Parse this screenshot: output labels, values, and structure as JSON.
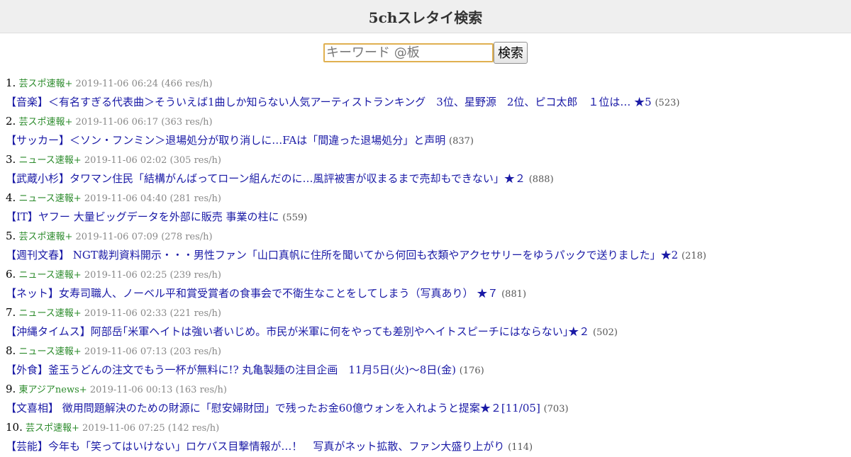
{
  "header": {
    "title": "5chスレタイ検索"
  },
  "search": {
    "placeholder": "キーワード @板",
    "value": "",
    "button_label": "検索"
  },
  "results": [
    {
      "rank": "1.",
      "board": "芸スポ速報+",
      "date": "2019-11-06 06:24",
      "rate": "(466 res/h)",
      "title": "【音楽】＜有名すぎる代表曲＞そういえば1曲しか知らない人気アーティストランキング　3位、星野源　2位、ピコ太郎　１位は… ★5",
      "count": "(523)"
    },
    {
      "rank": "2.",
      "board": "芸スポ速報+",
      "date": "2019-11-06 06:17",
      "rate": "(363 res/h)",
      "title": "【サッカー】＜ソン・フンミン＞退場処分が取り消しに…FAは「間違った退場処分」と声明",
      "count": "(837)"
    },
    {
      "rank": "3.",
      "board": "ニュース速報+",
      "date": "2019-11-06 02:02",
      "rate": "(305 res/h)",
      "title": "【武蔵小杉】タワマン住民「結構がんばってローン組んだのに…風評被害が収まるまで売却もできない」★２",
      "count": "(888)"
    },
    {
      "rank": "4.",
      "board": "ニュース速報+",
      "date": "2019-11-06 04:40",
      "rate": "(281 res/h)",
      "title": "【IT】ヤフー 大量ビッグデータを外部に販売 事業の柱に",
      "count": "(559)"
    },
    {
      "rank": "5.",
      "board": "芸スポ速報+",
      "date": "2019-11-06 07:09",
      "rate": "(278 res/h)",
      "title": "【週刊文春】 NGT裁判資料開示・・・男性ファン「山口真帆に住所を聞いてから何回も衣類やアクセサリーをゆうパックで送りました」★2",
      "count": "(218)"
    },
    {
      "rank": "6.",
      "board": "ニュース速報+",
      "date": "2019-11-06 02:25",
      "rate": "(239 res/h)",
      "title": "【ネット】女寿司職人、ノーベル平和賞受賞者の食事会で不衛生なことをしてしまう（写真あり） ★７",
      "count": "(881)"
    },
    {
      "rank": "7.",
      "board": "ニュース速報+",
      "date": "2019-11-06 02:33",
      "rate": "(221 res/h)",
      "title": "【沖縄タイムス】阿部岳｢米軍ヘイトは強い者いじめ。市民が米軍に何をやっても差別やヘイトスピーチにはならない｣★２",
      "count": "(502)"
    },
    {
      "rank": "8.",
      "board": "ニュース速報+",
      "date": "2019-11-06 07:13",
      "rate": "(203 res/h)",
      "title": "【外食】釜玉うどんの注文でもう一杯が無料に!? 丸亀製麺の注目企画　11月5日(火)～8日(金)",
      "count": "(176)"
    },
    {
      "rank": "9.",
      "board": "東アジアnews+",
      "date": "2019-11-06 00:13",
      "rate": "(163 res/h)",
      "title": "【文喜相】 徴用問題解決のための財源に「慰安婦財団」で残ったお金60億ウォンを入れようと提案★２[11/05]",
      "count": "(703)"
    },
    {
      "rank": "10.",
      "board": "芸スポ速報+",
      "date": "2019-11-06 07:25",
      "rate": "(142 res/h)",
      "title": "【芸能】今年も「笑ってはいけない」ロケバス目撃情報が…！　写真がネット拡散、ファン大盛り上がり",
      "count": "(114)"
    }
  ]
}
